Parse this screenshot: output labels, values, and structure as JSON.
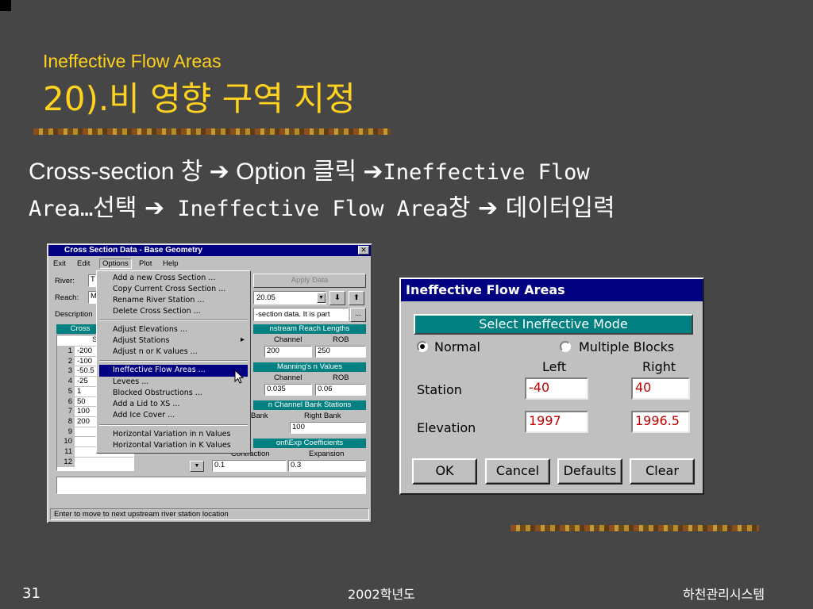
{
  "slide": {
    "subtitle": "Ineffective Flow Areas",
    "title": "20).비 영향 구역 지정",
    "line1_a": "Cross-section 창 ",
    "line1_arrow1": "➔",
    "line1_b": " Option 클릭 ",
    "line1_arrow2": "➔",
    "line1_c": "Ineffective Flow",
    "line2_a": "Area…",
    "line2_b": "선택 ",
    "line2_arrow1": "➔",
    "line2_c": " Ineffective Flow Area",
    "line2_d": "창 ",
    "line2_arrow2": "➔",
    "line2_e": " 데이터입력"
  },
  "footer": {
    "page_number": "31",
    "year": "2002학년도",
    "org": "하천관리시스템"
  },
  "xs_window": {
    "title": "Cross Section Data - Base Geometry",
    "close_glyph": "✕",
    "menubar": [
      "Exit",
      "Edit",
      "Options",
      "Plot",
      "Help"
    ],
    "river_label": "River:",
    "river_value": "T",
    "reach_label": "Reach:",
    "reach_value": "M",
    "description_label": "Description",
    "apply_button": "Apply Data",
    "river_station_value": "20.05",
    "description_value": "-section data.  It is part",
    "desc_button": "...",
    "down_arrow": "⬇",
    "up_arrow": "⬆",
    "cross_hdr": "Cross",
    "station_col": "S",
    "stations": [
      "-200",
      "-100",
      "-50.5",
      "-25",
      "1",
      "50",
      "100",
      "200",
      "",
      "",
      "",
      ""
    ],
    "row_numbers": [
      "1",
      "2",
      "3",
      "4",
      "5",
      "6",
      "7",
      "8",
      "9",
      "10",
      "11",
      "12"
    ],
    "reach_lengths_hdr": "nstream Reach Lengths",
    "channel_col": "Channel",
    "rob_col": "ROB",
    "channel_length": "200",
    "rob_length": "250",
    "mannings_hdr": "Manning's n Values",
    "channel_n": "0.035",
    "rob_n": "0.06",
    "bank_hdr": "n Channel Bank Stations",
    "left_bank_col": "Bank",
    "right_bank_col": "Right Bank",
    "right_bank_value": "100",
    "coef_hdr": "ont\\Exp  Coefficients",
    "contraction_col": "Contraction",
    "expansion_col": "Expansion",
    "contraction_value": "0.1",
    "expansion_value": "0.3",
    "status": "Enter to move to next upstream river station location"
  },
  "options_menu": {
    "items": [
      "Add a new Cross Section ...",
      "Copy Current Cross Section ...",
      "Rename River Station ...",
      "Delete Cross Section ...",
      "Adjust Elevations ...",
      "Adjust Stations",
      "Adjust n or K values ...",
      "Ineffective Flow Areas ...",
      "Levees ...",
      "Blocked Obstructions ...",
      "Add a Lid to XS ...",
      "Add Ice Cover ...",
      "Horizontal Variation in n Values",
      "Horizontal Variation in K Values"
    ],
    "submenu_arrow": "▸",
    "selected_index": 7
  },
  "dialog": {
    "title": "Ineffective Flow Areas",
    "mode_header": "Select Ineffective Mode",
    "normal_label": "Normal",
    "multiple_label": "Multiple Blocks",
    "selected_mode": "Normal",
    "left_col": "Left",
    "right_col": "Right",
    "station_label": "Station",
    "elevation_label": "Elevation",
    "station_left": "-40",
    "station_right": "40",
    "elevation_left": "1997",
    "elevation_right": "1996.5",
    "ok": "OK",
    "cancel": "Cancel",
    "defaults": "Defaults",
    "clear": "Clear"
  },
  "colors": {
    "background": "#464646",
    "title_yellow": "#ffd21f",
    "win_titlebar": "#000080",
    "teal_header": "#008080",
    "input_red": "#c00000"
  }
}
